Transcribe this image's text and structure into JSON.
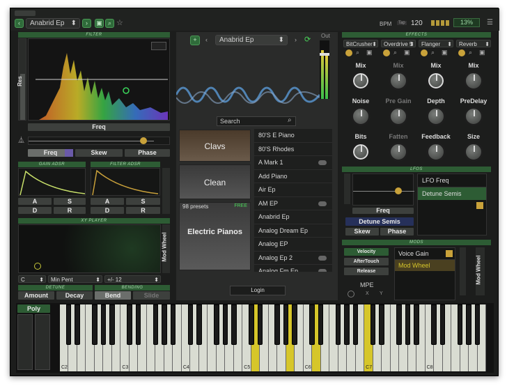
{
  "top": {
    "preset_name": "Anabrid Ep",
    "bpm_label": "BPM",
    "tap_label": "Tap",
    "bpm": "120",
    "cpu": "13%"
  },
  "filter": {
    "header": "FILTER",
    "res_label": "Res",
    "freq_label": "Freq",
    "freq_tab": "Freq",
    "skew_tab": "Skew",
    "phase_tab": "Phase"
  },
  "gain_adsr": {
    "header": "GAIN ADSR",
    "a": "A",
    "s": "S",
    "d": "D",
    "r": "R"
  },
  "filter_adsr": {
    "header": "FILTER ADSR",
    "a": "A",
    "s": "S",
    "d": "D",
    "r": "R"
  },
  "xy": {
    "header": "XY PLAYER",
    "side_label": "Mod Wheel",
    "key": "C",
    "scale": "Min Pent",
    "range": "+/- 12"
  },
  "detune": {
    "header": "DETUNE",
    "amount": "Amount",
    "decay": "Decay"
  },
  "bending": {
    "header": "BENDING",
    "bend": "Bend",
    "slide": "Slide"
  },
  "browser": {
    "preset": "Anabrid Ep",
    "out_label": "Out",
    "search_placeholder": "Search",
    "tiles": [
      {
        "label": "Clavs"
      },
      {
        "label": "Clean"
      },
      {
        "label": "Electric Pianos",
        "count": "98 presets",
        "badge": "FREE"
      }
    ],
    "items": [
      "80'S E Piano",
      "80'S Rhodes",
      "A Mark 1",
      "Add Piano",
      "Air Ep",
      "AM EP",
      "Anabrid Ep",
      "Analog Dream Ep",
      "Analog EP",
      "Analog Ep 2",
      "Analog Fm Ep"
    ],
    "login": "Login"
  },
  "effects": {
    "header": "EFFECTS",
    "slots": [
      "BitCrusher",
      "Overdrive 5",
      "Flanger",
      "Reverb"
    ],
    "knobs": [
      [
        "Mix",
        "Noise",
        "Bits"
      ],
      [
        "Mix",
        "Pre Gain",
        "Fatten"
      ],
      [
        "Mix",
        "Depth",
        "Feedback"
      ],
      [
        "Mix",
        "PreDelay",
        "Size"
      ]
    ]
  },
  "lfos": {
    "header": "LFOS",
    "freq": "Freq",
    "target": "Detune Semis",
    "skew": "Skew",
    "phase": "Phase",
    "list": [
      "LFO Freq",
      "Detune Semis"
    ]
  },
  "mods": {
    "header": "MODS",
    "sources": [
      "Velocity",
      "AfterTouch",
      "Release"
    ],
    "mpe": "MPE",
    "x": "X",
    "y": "Y",
    "targets": [
      "Voice Gain",
      "Mod Wheel"
    ],
    "side": "Mod Wheel"
  },
  "keyboard": {
    "poly": "Poly",
    "octaves": [
      "C2",
      "C3",
      "C4",
      "C5",
      "C6",
      "C7",
      "C8"
    ]
  }
}
